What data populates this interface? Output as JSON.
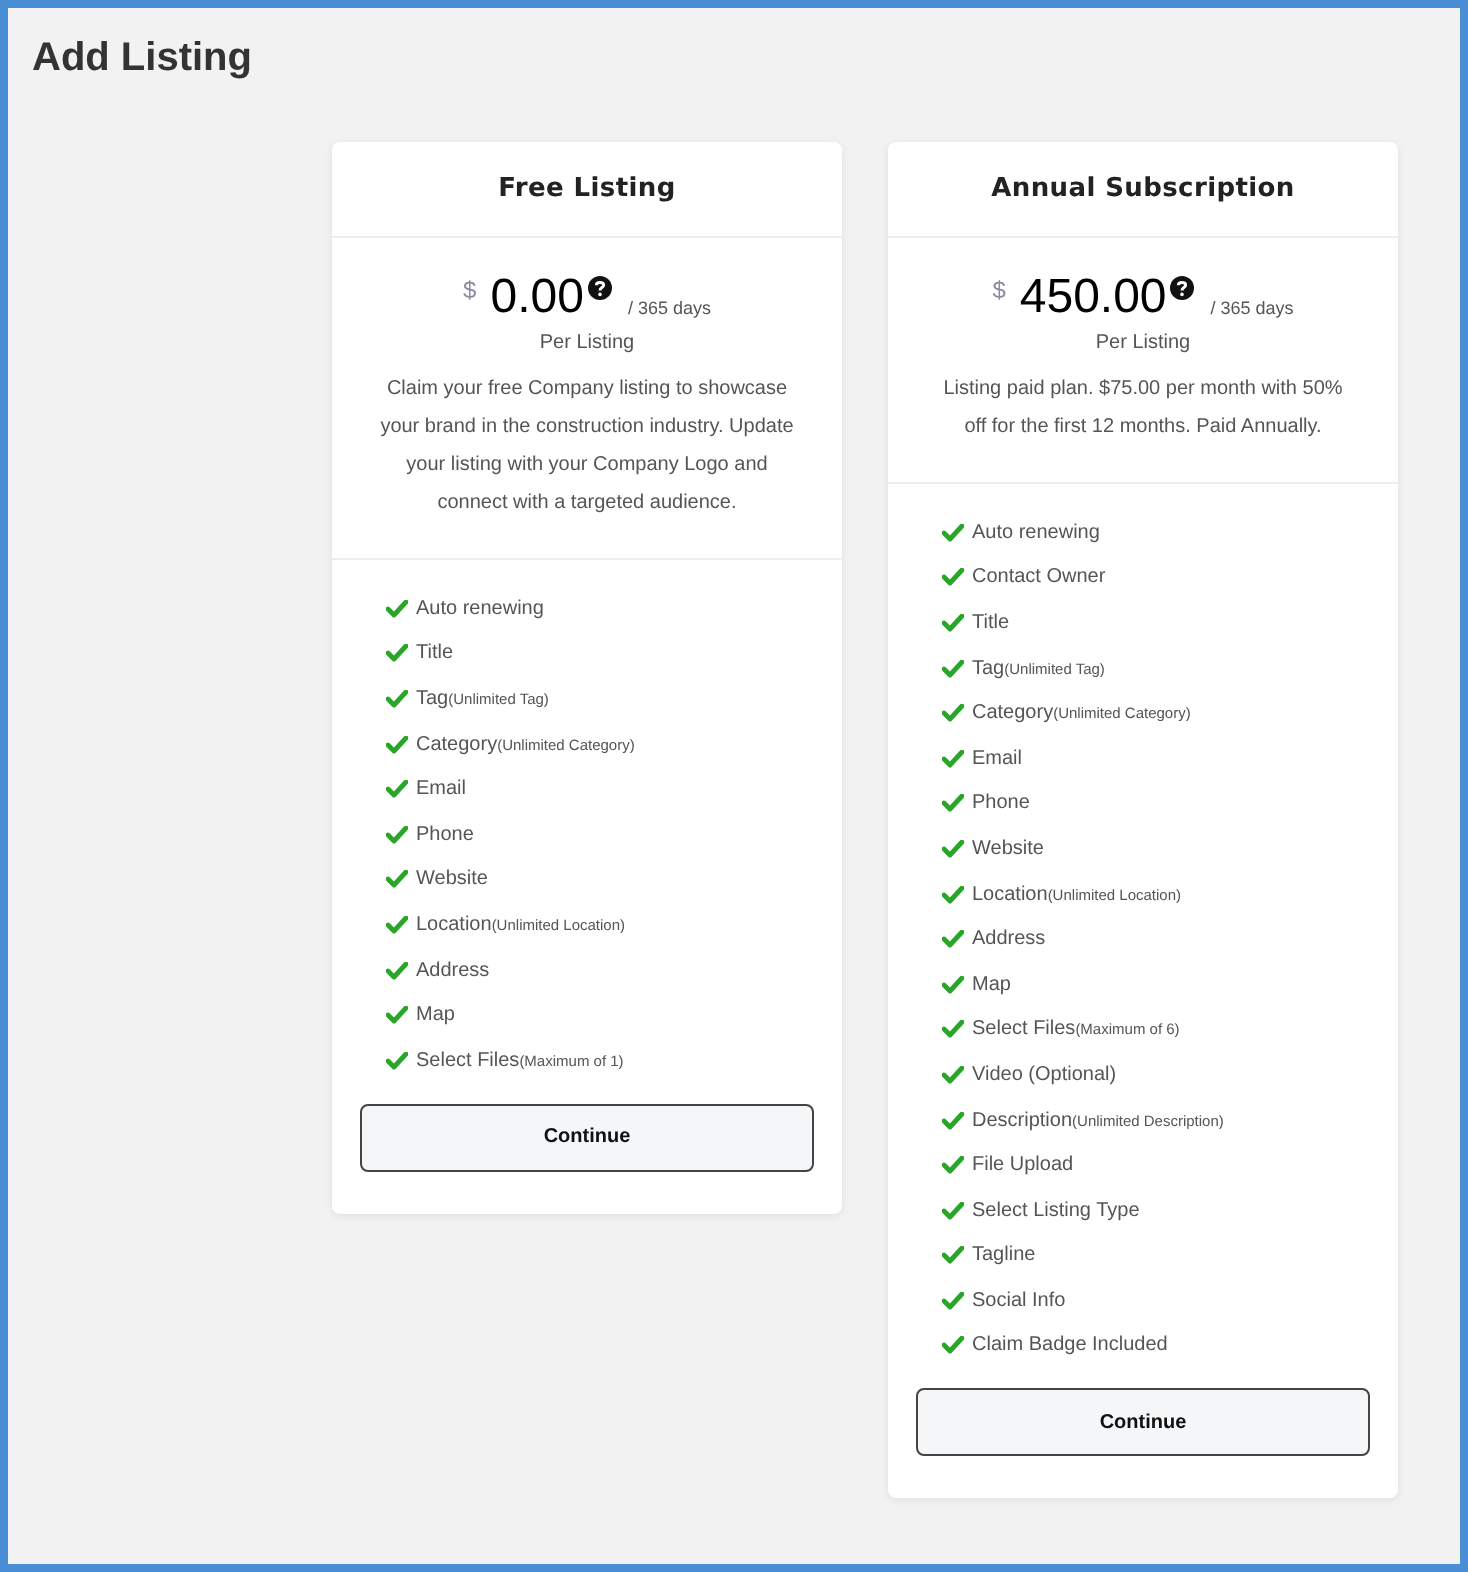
{
  "page_title": "Add Listing",
  "plans": [
    {
      "name": "Free Listing",
      "currency": "$",
      "price": "0.00",
      "period": "/ 365 days",
      "unit": "Per Listing",
      "description": "Claim your free Company listing to showcase your brand in the construction industry. Update your listing with your Company Logo and connect with a targeted audience.",
      "features": [
        {
          "label": "Auto renewing"
        },
        {
          "label": "Title"
        },
        {
          "label": "Tag",
          "note": "(Unlimited Tag)"
        },
        {
          "label": "Category",
          "note": "(Unlimited Category)"
        },
        {
          "label": "Email"
        },
        {
          "label": "Phone"
        },
        {
          "label": "Website"
        },
        {
          "label": "Location",
          "note": "(Unlimited Location)"
        },
        {
          "label": "Address"
        },
        {
          "label": "Map"
        },
        {
          "label": "Select Files",
          "note": "(Maximum of 1)"
        }
      ],
      "button": "Continue"
    },
    {
      "name": "Annual Subscription",
      "currency": "$",
      "price": "450.00",
      "period": "/ 365 days",
      "unit": "Per Listing",
      "description": "Listing paid plan. $75.00 per month with 50% off for the first 12 months. Paid Annually.",
      "features": [
        {
          "label": "Auto renewing"
        },
        {
          "label": "Contact Owner"
        },
        {
          "label": "Title"
        },
        {
          "label": "Tag",
          "note": "(Unlimited Tag)"
        },
        {
          "label": "Category",
          "note": "(Unlimited Category)"
        },
        {
          "label": "Email"
        },
        {
          "label": "Phone"
        },
        {
          "label": "Website"
        },
        {
          "label": "Location",
          "note": "(Unlimited Location)"
        },
        {
          "label": "Address"
        },
        {
          "label": "Map"
        },
        {
          "label": "Select Files",
          "note": "(Maximum of 6)"
        },
        {
          "label": "Video (Optional)"
        },
        {
          "label": "Description",
          "note": "(Unlimited Description)"
        },
        {
          "label": "File Upload"
        },
        {
          "label": "Select Listing Type"
        },
        {
          "label": "Tagline"
        },
        {
          "label": "Social Info"
        },
        {
          "label": "Claim Badge Included"
        }
      ],
      "button": "Continue"
    }
  ]
}
